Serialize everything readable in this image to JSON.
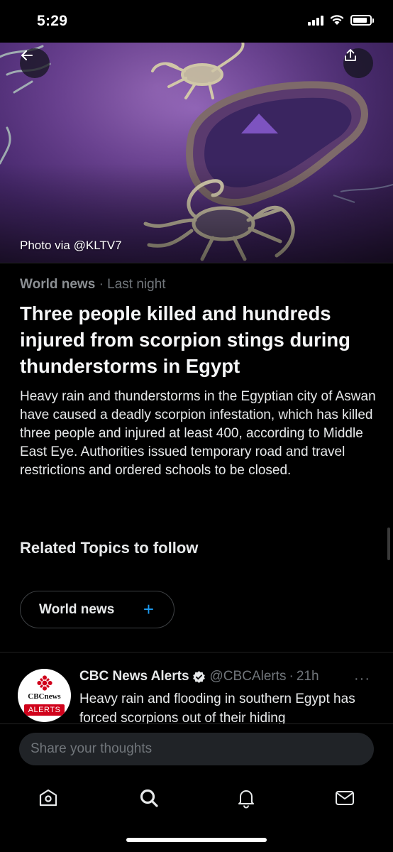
{
  "status_bar": {
    "time": "5:29",
    "battery_level": 0.85
  },
  "hero": {
    "photo_credit": "Photo via @KLTV7",
    "back_icon": "back-arrow-icon",
    "share_icon": "share-icon"
  },
  "article": {
    "category": "World news",
    "separator": "·",
    "time": "Last night",
    "headline": "Three people killed and hundreds injured from scorpion stings during thunderstorms in Egypt",
    "summary": "Heavy rain and thunderstorms in the Egyptian city of Aswan have caused a deadly scorpion infestation, which has killed three people and injured at least 400, according to Middle East Eye. Authorities issued temporary road and travel restrictions and ordered schools to be closed."
  },
  "related": {
    "title": "Related Topics to follow",
    "topics": [
      {
        "label": "World news",
        "action": "+"
      }
    ]
  },
  "tweet": {
    "name": "CBC News Alerts",
    "handle": "@CBCAlerts",
    "separator": "·",
    "time": "21h",
    "more": "···",
    "text": "Heavy rain and flooding in southern Egypt has forced scorpions out of their hiding",
    "avatar_word": "CBCnews",
    "avatar_badge": "ALERTS",
    "verified": true
  },
  "reply": {
    "placeholder": "Share your thoughts"
  },
  "nav": {
    "items": [
      {
        "name": "home",
        "icon": "home-icon"
      },
      {
        "name": "search",
        "icon": "search-icon"
      },
      {
        "name": "notifications",
        "icon": "bell-icon"
      },
      {
        "name": "messages",
        "icon": "mail-icon"
      }
    ]
  },
  "colors": {
    "background": "#000000",
    "accent": "#1d9bf0",
    "muted_text": "#71767b",
    "primary_text": "#e7e9ea",
    "cbc_red": "#d0021b"
  }
}
